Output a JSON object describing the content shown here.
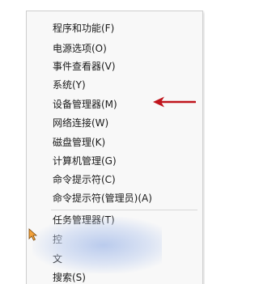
{
  "menu": {
    "items": [
      {
        "label": "程序和功能(F)"
      },
      {
        "label": "电源选项(O)"
      },
      {
        "label": "事件查看器(V)"
      },
      {
        "label": "系统(Y)"
      },
      {
        "label": "设备管理器(M)"
      },
      {
        "label": "网络连接(W)"
      },
      {
        "label": "磁盘管理(K)"
      },
      {
        "label": "计算机管理(G)"
      },
      {
        "label": "命令提示符(C)"
      },
      {
        "label": "命令提示符(管理员)(A)"
      },
      {
        "label": "任务管理器(T)"
      },
      {
        "label": "控"
      },
      {
        "label": "文"
      },
      {
        "label": "搜索(S)"
      }
    ]
  },
  "annotation": {
    "arrow_color": "#c0141c"
  }
}
